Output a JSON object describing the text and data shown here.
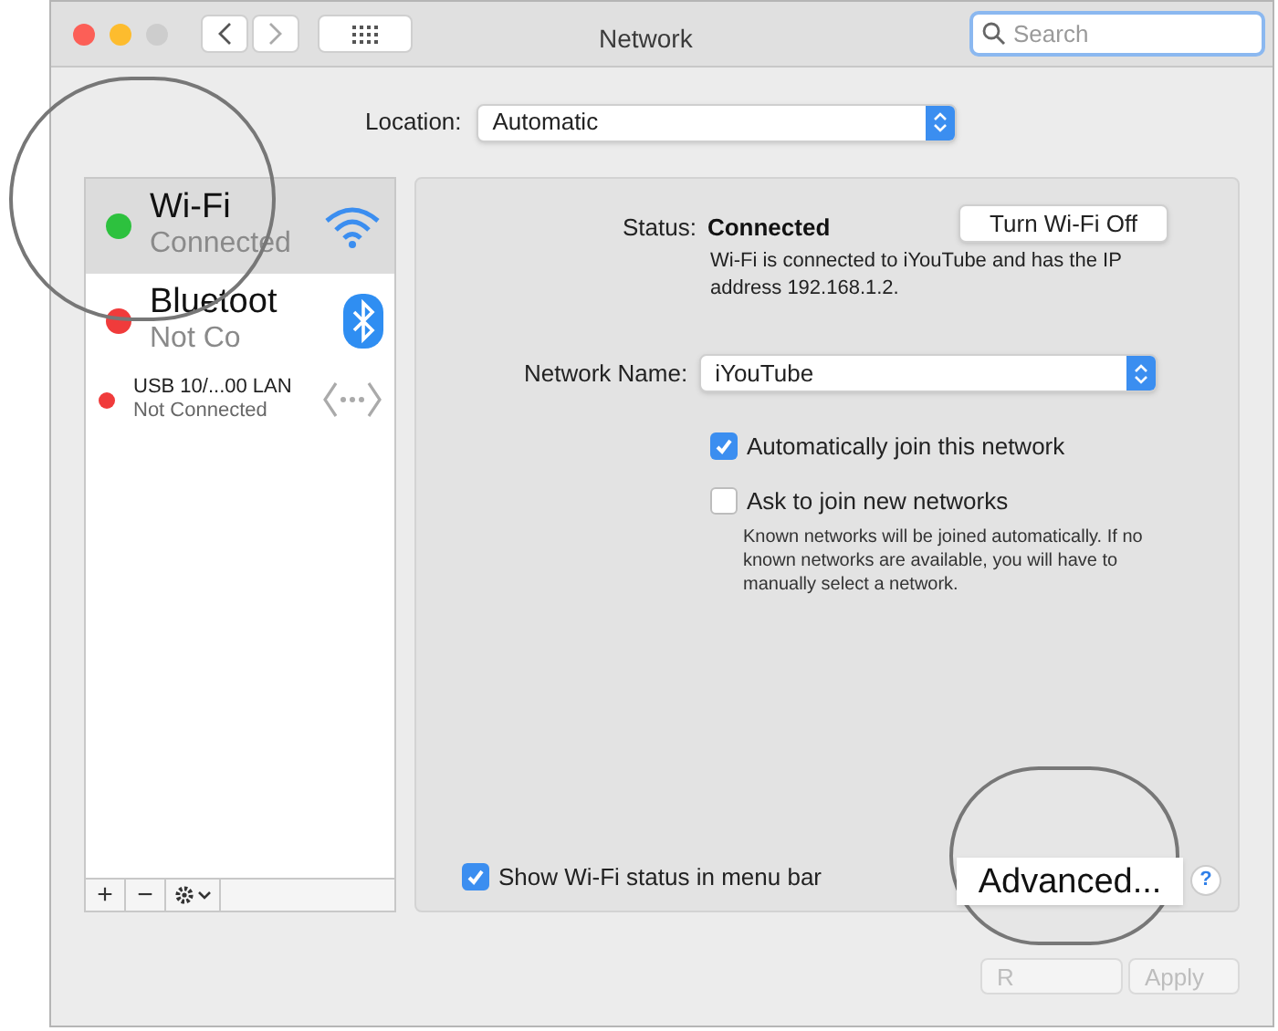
{
  "window": {
    "title": "Network"
  },
  "search": {
    "placeholder": "Search"
  },
  "location": {
    "label": "Location:",
    "value": "Automatic"
  },
  "services": [
    {
      "name": "Wi-Fi",
      "status": "Connected",
      "color": "#2dc13e",
      "selected": true,
      "kind": "wifi",
      "large": true
    },
    {
      "name": "Bluetoot",
      "status": "Not Co",
      "color": "#f03b3b",
      "selected": false,
      "kind": "bluetooth",
      "large": true
    },
    {
      "name": "USB 10/...00 LAN",
      "status": "Not Connected",
      "color": "#f03b3b",
      "selected": false,
      "kind": "ethernet",
      "large": false
    }
  ],
  "list_buttons": [
    "+",
    "−"
  ],
  "status": {
    "label": "Status:",
    "value": "Connected",
    "button": "Turn Wi-Fi Off",
    "description": "Wi-Fi is connected to iYouTube and has the IP address 192.168.1.2."
  },
  "network_name": {
    "label": "Network Name:",
    "value": "iYouTube"
  },
  "options": [
    {
      "label": "Automatically join this network",
      "checked": true
    },
    {
      "label": "Ask to join new networks",
      "checked": false
    }
  ],
  "options_note": "Known networks will be joined automatically. If no known networks are available, you will have to manually select a network.",
  "show_status": {
    "label": "Show Wi-Fi status in menu bar",
    "checked": true
  },
  "advanced_button": "Advanced...",
  "help_button": "?",
  "footer_buttons": [
    {
      "label": "R",
      "disabled": true
    },
    {
      "label": "Apply",
      "disabled": true
    }
  ]
}
